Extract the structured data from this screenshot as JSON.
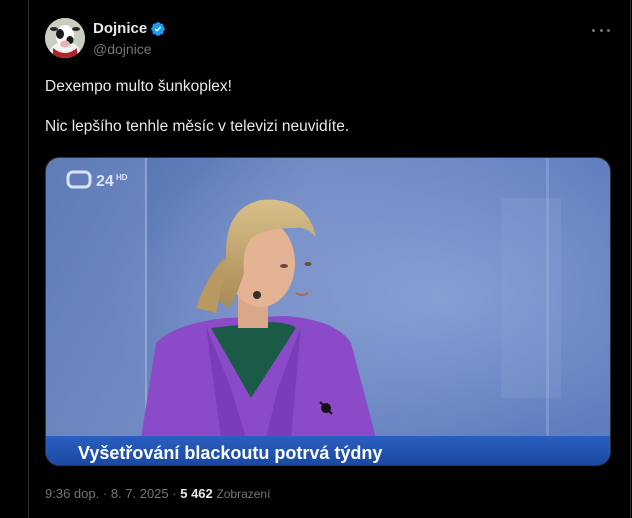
{
  "post": {
    "author_name": "Dojnice",
    "handle": "@dojnice",
    "text_line_1": "Dexempo multo šunkoplex!",
    "text_line_2": "Nic lepšího tenhle měsíc v televizi neuvidíte.",
    "media": {
      "channel_logo": "ČT",
      "channel_number": "24",
      "channel_hd": "HD",
      "caption": "Vyšetřování blackoutu potrvá týdny"
    },
    "time": "9:36 dop.",
    "separator": "·",
    "date": "8. 7. 2025",
    "views_count": "5 462",
    "views_label": "Zobrazení"
  },
  "icons": {
    "verified": "verified-badge-icon",
    "more": "more-options-icon"
  },
  "colors": {
    "background": "#000000",
    "text": "#e7e9ea",
    "muted": "#71767b",
    "verified": "#1d9bf0",
    "caption_bar": "#1d4fa8"
  }
}
